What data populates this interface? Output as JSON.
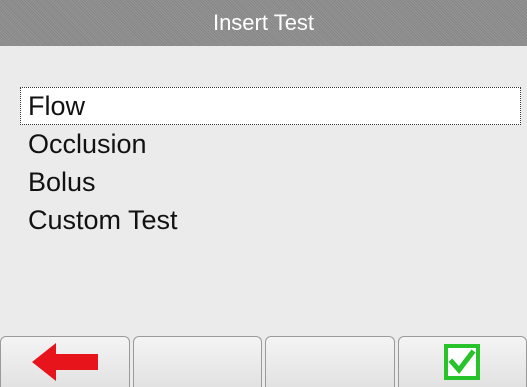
{
  "header": {
    "title": "Insert Test"
  },
  "tests": [
    {
      "label": "Flow",
      "selected": true
    },
    {
      "label": "Occlusion",
      "selected": false
    },
    {
      "label": "Bolus",
      "selected": false
    },
    {
      "label": "Custom Test",
      "selected": false
    }
  ],
  "toolbar": {
    "buttons": [
      {
        "name": "back-button",
        "icon": "back-arrow-icon"
      },
      {
        "name": "toolbar-button-2",
        "icon": ""
      },
      {
        "name": "toolbar-button-3",
        "icon": ""
      },
      {
        "name": "confirm-button",
        "icon": "checkbox-checked-icon"
      }
    ]
  },
  "colors": {
    "title_bar": "#8e8e8e",
    "background": "#ebebeb",
    "back_arrow": "#e8141c",
    "check": "#27c32a"
  }
}
